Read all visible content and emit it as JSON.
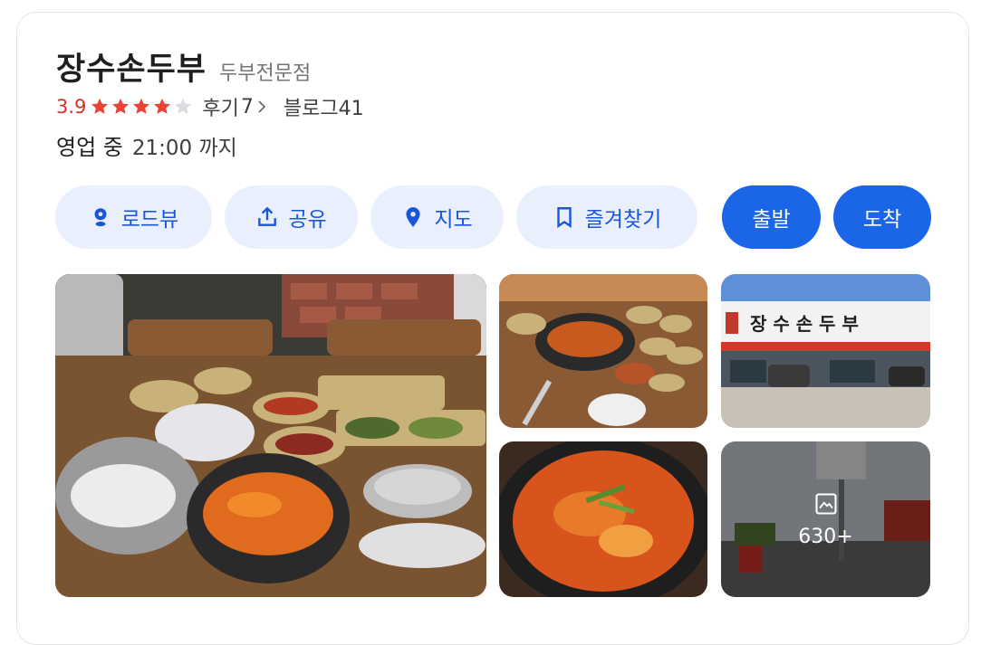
{
  "place": {
    "name": "장수손두부",
    "category": "두부전문점",
    "rating": "3.9",
    "stars_filled": 4,
    "stars_total": 5,
    "reviews_label": "후기",
    "reviews_count": "7",
    "blog_label": "블로그",
    "blog_count": "41",
    "status": "영업 중",
    "hours": "21:00 까지"
  },
  "actions": {
    "roadview": "로드뷰",
    "share": "공유",
    "map": "지도",
    "bookmark": "즐겨찾기",
    "depart": "출발",
    "arrive": "도착"
  },
  "photos": {
    "more_count": "630+",
    "sign_text": "장 수 손 두 부"
  },
  "colors": {
    "accent": "#1b66e7",
    "pill_bg": "#e9effd",
    "rating": "#d93025",
    "star": "#ea4335"
  }
}
